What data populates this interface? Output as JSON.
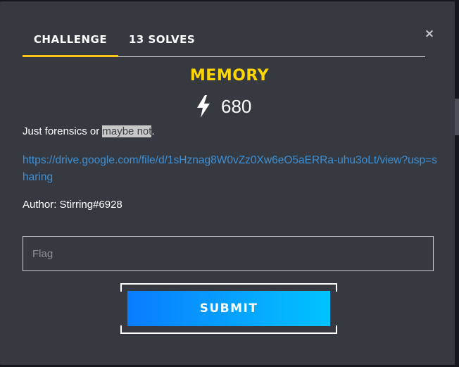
{
  "tabs": [
    {
      "label": "Challenge",
      "active": true
    },
    {
      "label": "13 Solves",
      "active": false
    }
  ],
  "close": {
    "glyph": "×",
    "icon": "close-icon"
  },
  "challenge": {
    "name": "Memory",
    "points_icon": "lightning-bolt-icon",
    "points": "680",
    "description_before": "Just forensics or ",
    "description_highlight": "maybe not",
    "description_after": ".",
    "link": "https://drive.google.com/file/d/1sHznag8W0vZz0Xw6eO5aERRa-uhu3oLt/view?usp=sharing",
    "author": "Author: Stirring#6928"
  },
  "flag_input": {
    "placeholder": "Flag",
    "value": ""
  },
  "submit": {
    "label": "Submit"
  },
  "colors": {
    "modal_bg": "#363a40",
    "title": "#ffd600",
    "tab_underline": "#f7c31a",
    "link": "#3d8fd6",
    "button_gradient_start": "#0a7cff",
    "button_gradient_end": "#00c3ff"
  }
}
